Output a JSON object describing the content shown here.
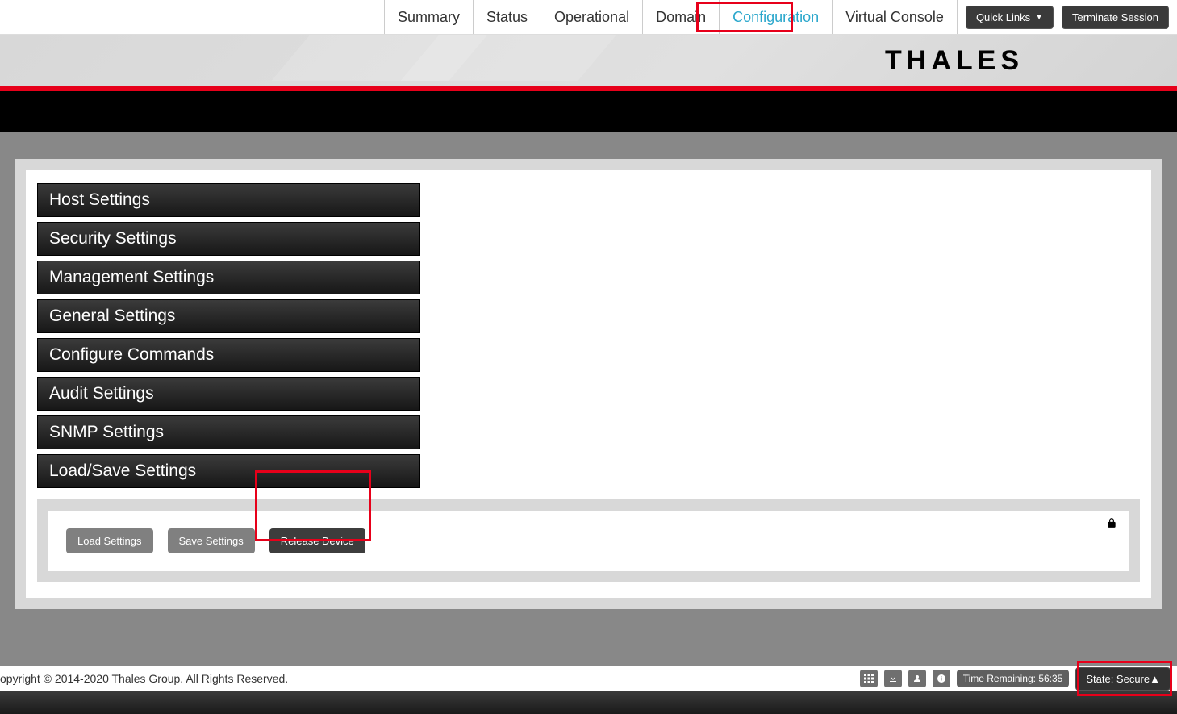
{
  "nav": {
    "tabs": [
      {
        "label": "Summary"
      },
      {
        "label": "Status"
      },
      {
        "label": "Operational"
      },
      {
        "label": "Domain"
      },
      {
        "label": "Configuration",
        "active": true
      },
      {
        "label": "Virtual Console"
      }
    ],
    "quick_links_label": "Quick Links",
    "terminate_label": "Terminate Session"
  },
  "brand": "THALES",
  "sidebar": {
    "items": [
      {
        "label": "Host Settings"
      },
      {
        "label": "Security Settings"
      },
      {
        "label": "Management Settings"
      },
      {
        "label": "General Settings"
      },
      {
        "label": "Configure Commands"
      },
      {
        "label": "Audit Settings"
      },
      {
        "label": "SNMP Settings"
      },
      {
        "label": "Load/Save Settings"
      }
    ]
  },
  "actions": {
    "load_label": "Load Settings",
    "save_label": "Save Settings",
    "release_label": "Release Device"
  },
  "footer": {
    "copyright": "opyright © 2014-2020 Thales Group. All Rights Reserved.",
    "time_remaining_label": "Time Remaining:",
    "time_remaining_value": "56:35",
    "state_label": "State: Secure"
  },
  "highlights": {
    "configuration_tab": true,
    "release_device": true,
    "state_secure": true
  }
}
